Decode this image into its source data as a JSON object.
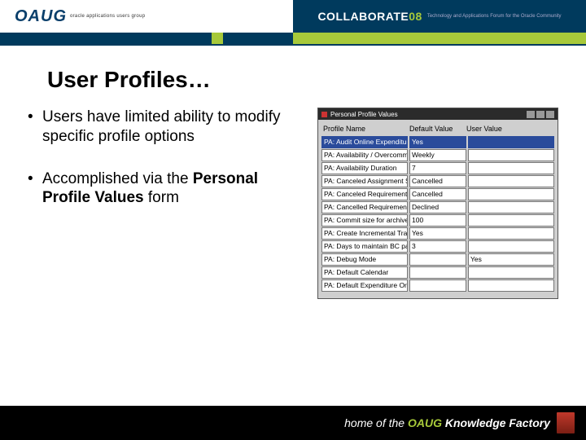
{
  "header": {
    "logo_text": "OAUG",
    "logo_sub": "oracle applications users group",
    "collab_prefix": "COLLABORATE",
    "collab_num": "08",
    "collab_tagline": "Technology and Applications Forum for the Oracle Community"
  },
  "slide": {
    "title": "User Profiles…",
    "bullet1": "Users have limited ability to modify specific profile options",
    "bullet2_a": "Accomplished via the ",
    "bullet2_b": "Personal Profile Values",
    "bullet2_c": " form"
  },
  "form": {
    "window_title": "Personal Profile Values",
    "col_profile": "Profile Name",
    "col_default": "Default Value",
    "col_user": "User Value",
    "rows": [
      {
        "name": "PA: Audit Online Expenditure E",
        "def": "Yes",
        "user": "",
        "selected": true
      },
      {
        "name": "PA: Availability / Overcommitm",
        "def": "Weekly",
        "user": "",
        "selected": false
      },
      {
        "name": "PA: Availability Duration",
        "def": "7",
        "user": "",
        "selected": false
      },
      {
        "name": "PA: Canceled Assignment Statu",
        "def": "Cancelled",
        "user": "",
        "selected": false
      },
      {
        "name": "PA: Canceled Requirement Sta",
        "def": "Cancelled",
        "user": "",
        "selected": false
      },
      {
        "name": "PA: Cancelled Requirement's C",
        "def": "Declined",
        "user": "",
        "selected": false
      },
      {
        "name": "PA: Commit size for archive an",
        "def": "100",
        "user": "",
        "selected": false
      },
      {
        "name": "PA: Create Incremental Transa",
        "def": "Yes",
        "user": "",
        "selected": false
      },
      {
        "name": "PA: Days to maintain BC packe",
        "def": "3",
        "user": "",
        "selected": false
      },
      {
        "name": "PA: Debug Mode",
        "def": "",
        "user": "Yes",
        "selected": false
      },
      {
        "name": "PA: Default Calendar",
        "def": "",
        "user": "",
        "selected": false
      },
      {
        "name": "PA: Default Expenditure Organi",
        "def": "",
        "user": "",
        "selected": false
      }
    ]
  },
  "footer": {
    "prefix": "home of the ",
    "brand": "OAUG",
    "suffix": " Knowledge Factory"
  }
}
